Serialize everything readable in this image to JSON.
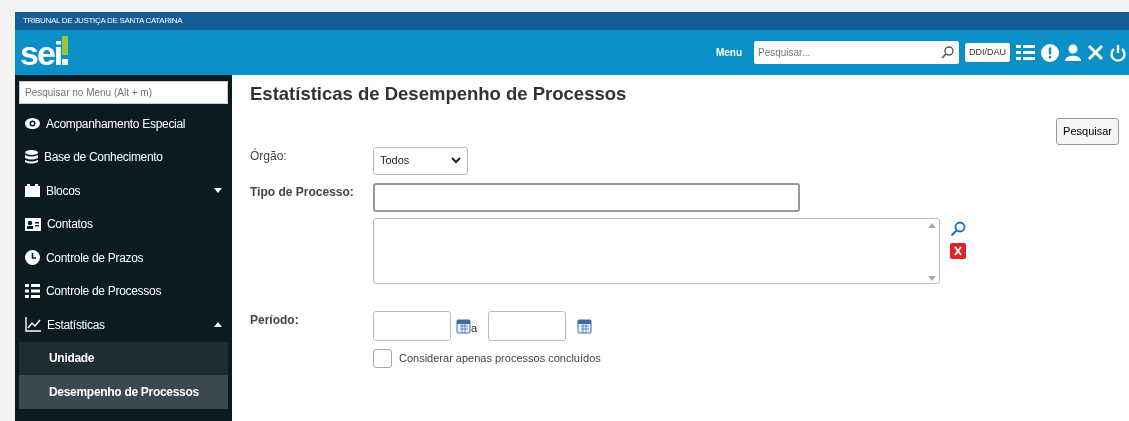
{
  "header": {
    "org": "TRIBUNAL DE JUSTIÇA DE SANTA CATARINA",
    "logo": "sei",
    "menu_label": "Menu",
    "search": {
      "placeholder": "Pesquisar..."
    },
    "unit": "DDI/DAU"
  },
  "sidebar": {
    "search": {
      "placeholder": "Pesquisar no Menu (Alt + m)"
    },
    "items": [
      {
        "label": "Acompanhamento Especial",
        "selected": false
      },
      {
        "label": "Base de Conhecimento",
        "selected": false
      },
      {
        "label": "Blocos",
        "selected": false,
        "expanded": false
      },
      {
        "label": "Contatos",
        "selected": false
      },
      {
        "label": "Controle de Prazos",
        "selected": false
      },
      {
        "label": "Controle de Processos",
        "selected": false
      },
      {
        "label": "Estatísticas",
        "selected": false,
        "expanded": true,
        "children": [
          {
            "label": "Unidade",
            "selected": false
          },
          {
            "label": "Desempenho de Processos",
            "selected": true
          }
        ]
      }
    ]
  },
  "content": {
    "title": "Estatísticas de Desempenho de Processos",
    "search_button": "Pesquisar",
    "orgao": {
      "label": "Órgão:",
      "value": "Todos"
    },
    "tipo": {
      "label": "Tipo de Processo:"
    },
    "periodo": {
      "label": "Período:",
      "separator": "a"
    },
    "only_concluded": {
      "label": "Considerar apenas processos concluídos",
      "checked": false
    }
  }
}
